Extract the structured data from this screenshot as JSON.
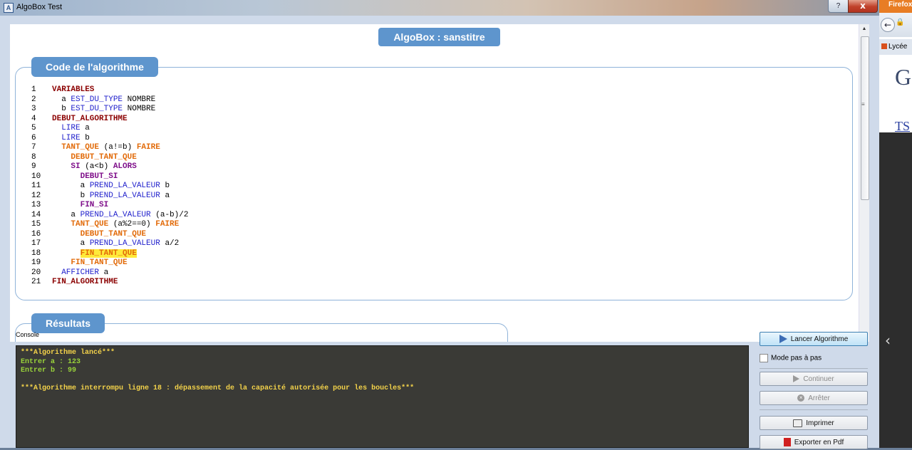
{
  "window": {
    "title": "AlgoBox Test",
    "help_label": "?",
    "close_label": "x"
  },
  "page": {
    "title": "AlgoBox : sanstitre"
  },
  "code_section": {
    "legend": "Code de l'algorithme",
    "lines": [
      {
        "n": "1",
        "parts": [
          {
            "t": "VARIABLES",
            "c": "kw-dark"
          }
        ]
      },
      {
        "n": "2",
        "parts": [
          {
            "t": "  a ",
            "c": "txt"
          },
          {
            "t": "EST_DU_TYPE",
            "c": "kw-blue"
          },
          {
            "t": " NOMBRE",
            "c": "txt"
          }
        ]
      },
      {
        "n": "3",
        "parts": [
          {
            "t": "  b ",
            "c": "txt"
          },
          {
            "t": "EST_DU_TYPE",
            "c": "kw-blue"
          },
          {
            "t": " NOMBRE",
            "c": "txt"
          }
        ]
      },
      {
        "n": "4",
        "parts": [
          {
            "t": "DEBUT_ALGORITHME",
            "c": "kw-dark"
          }
        ]
      },
      {
        "n": "5",
        "parts": [
          {
            "t": "  ",
            "c": "txt"
          },
          {
            "t": "LIRE",
            "c": "kw-blue"
          },
          {
            "t": " a",
            "c": "txt"
          }
        ]
      },
      {
        "n": "6",
        "parts": [
          {
            "t": "  ",
            "c": "txt"
          },
          {
            "t": "LIRE",
            "c": "kw-blue"
          },
          {
            "t": " b",
            "c": "txt"
          }
        ]
      },
      {
        "n": "7",
        "parts": [
          {
            "t": "  ",
            "c": "txt"
          },
          {
            "t": "TANT_QUE",
            "c": "kw-orange"
          },
          {
            "t": " (a!=b) ",
            "c": "txt"
          },
          {
            "t": "FAIRE",
            "c": "kw-orange"
          }
        ]
      },
      {
        "n": "8",
        "parts": [
          {
            "t": "    ",
            "c": "txt"
          },
          {
            "t": "DEBUT_TANT_QUE",
            "c": "kw-orange"
          }
        ]
      },
      {
        "n": "9",
        "parts": [
          {
            "t": "    ",
            "c": "txt"
          },
          {
            "t": "SI",
            "c": "kw-purple"
          },
          {
            "t": " (a<b) ",
            "c": "txt"
          },
          {
            "t": "ALORS",
            "c": "kw-purple"
          }
        ]
      },
      {
        "n": "10",
        "parts": [
          {
            "t": "      ",
            "c": "txt"
          },
          {
            "t": "DEBUT_SI",
            "c": "kw-purple"
          }
        ]
      },
      {
        "n": "11",
        "parts": [
          {
            "t": "      a ",
            "c": "txt"
          },
          {
            "t": "PREND_LA_VALEUR",
            "c": "kw-blue"
          },
          {
            "t": " b",
            "c": "txt"
          }
        ]
      },
      {
        "n": "12",
        "parts": [
          {
            "t": "      b ",
            "c": "txt"
          },
          {
            "t": "PREND_LA_VALEUR",
            "c": "kw-blue"
          },
          {
            "t": " a",
            "c": "txt"
          }
        ]
      },
      {
        "n": "13",
        "parts": [
          {
            "t": "      ",
            "c": "txt"
          },
          {
            "t": "FIN_SI",
            "c": "kw-purple"
          }
        ]
      },
      {
        "n": "14",
        "parts": [
          {
            "t": "    a ",
            "c": "txt"
          },
          {
            "t": "PREND_LA_VALEUR",
            "c": "kw-blue"
          },
          {
            "t": " (a-b)/2",
            "c": "txt"
          }
        ]
      },
      {
        "n": "15",
        "parts": [
          {
            "t": "    ",
            "c": "txt"
          },
          {
            "t": "TANT_QUE",
            "c": "kw-orange"
          },
          {
            "t": " (a%2==0) ",
            "c": "txt"
          },
          {
            "t": "FAIRE",
            "c": "kw-orange"
          }
        ]
      },
      {
        "n": "16",
        "parts": [
          {
            "t": "      ",
            "c": "txt"
          },
          {
            "t": "DEBUT_TANT_QUE",
            "c": "kw-orange"
          }
        ]
      },
      {
        "n": "17",
        "parts": [
          {
            "t": "      a ",
            "c": "txt"
          },
          {
            "t": "PREND_LA_VALEUR",
            "c": "kw-blue"
          },
          {
            "t": " a/2",
            "c": "txt"
          }
        ]
      },
      {
        "n": "18",
        "parts": [
          {
            "t": "      ",
            "c": "txt"
          },
          {
            "t": "FIN_TANT_QUE",
            "c": "kw-orange kw-hl"
          }
        ]
      },
      {
        "n": "19",
        "parts": [
          {
            "t": "    ",
            "c": "txt"
          },
          {
            "t": "FIN_TANT_QUE",
            "c": "kw-orange"
          }
        ]
      },
      {
        "n": "20",
        "parts": [
          {
            "t": "  ",
            "c": "txt"
          },
          {
            "t": "AFFICHER",
            "c": "kw-blue"
          },
          {
            "t": " a",
            "c": "txt"
          }
        ]
      },
      {
        "n": "21",
        "parts": [
          {
            "t": "FIN_ALGORITHME",
            "c": "kw-dark"
          }
        ]
      }
    ]
  },
  "results_section": {
    "legend": "Résultats"
  },
  "console": {
    "label": "Console",
    "lines": [
      {
        "t": "***Algorithme lancé***",
        "c": "out-yellow"
      },
      {
        "t": "Entrer a : 123",
        "c": "out-green"
      },
      {
        "t": "Entrer b : 99",
        "c": "out-green"
      },
      {
        "t": "",
        "c": "out-yellow"
      },
      {
        "t": "***Algorithme interrompu ligne 18 : dépassement de la capacité autorisée pour les boucles***",
        "c": "out-yellow"
      }
    ]
  },
  "controls": {
    "run_label": "Lancer Algorithme",
    "step_mode_label": "Mode pas à pas",
    "continue_label": "Continuer",
    "stop_label": "Arrêter",
    "print_label": "Imprimer",
    "export_pdf_label": "Exporter en Pdf"
  },
  "firefox": {
    "title": "Firefox",
    "bookmark": "Lycée",
    "big_text": "G",
    "link_text": "TS"
  }
}
